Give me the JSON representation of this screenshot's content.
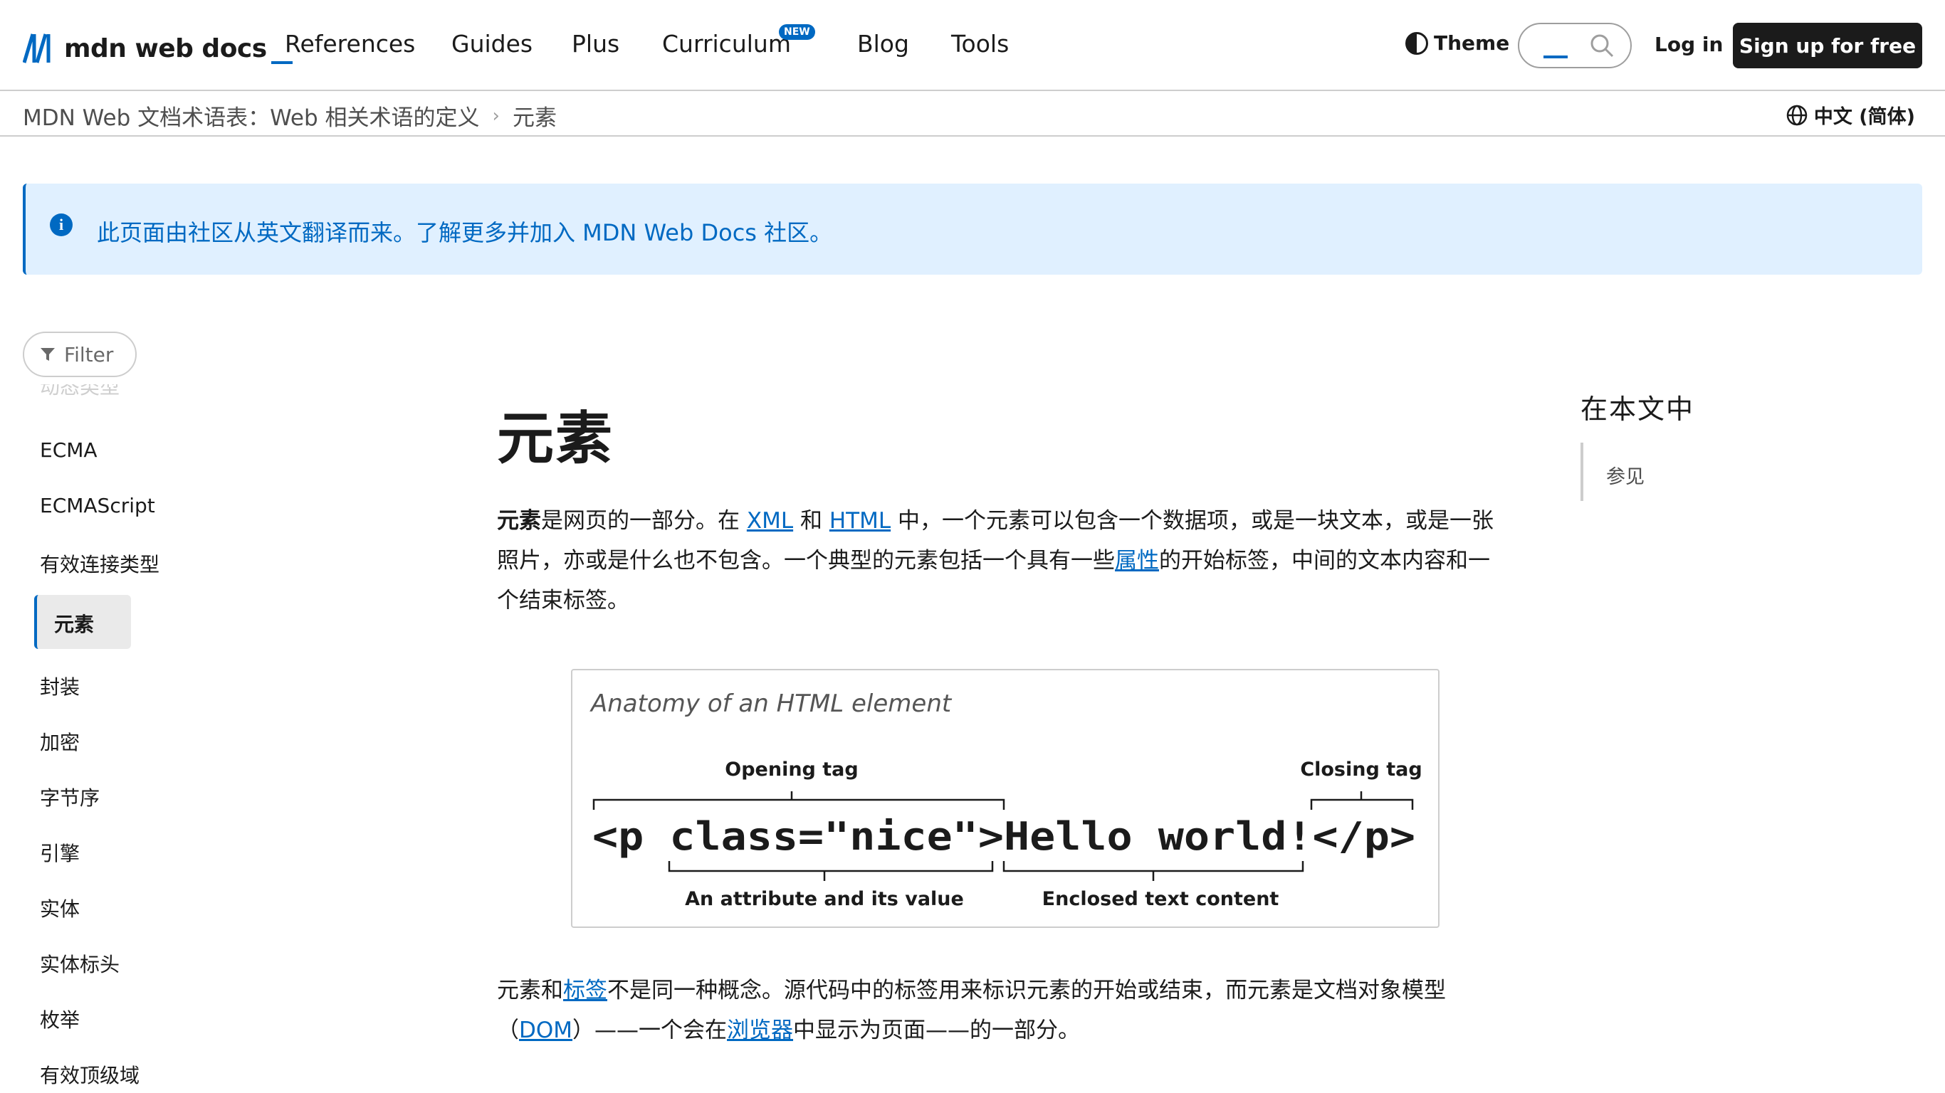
{
  "header": {
    "logo_text": "mdn web docs",
    "nav": [
      "References",
      "Guides",
      "Plus",
      "Curriculum",
      "Blog",
      "Tools"
    ],
    "curriculum_badge": "NEW",
    "theme_label": "Theme",
    "search_placeholder": "",
    "login_label": "Log in",
    "signup_label": "Sign up for free"
  },
  "breadcrumb": {
    "items": [
      "MDN Web 文档术语表：Web 相关术语的定义",
      "元素"
    ],
    "language": "中文 (简体)"
  },
  "notice": {
    "text": "此页面由社区从英文翻译而来。了解更多并加入 MDN Web Docs 社区。"
  },
  "sidebar": {
    "filter_label": "Filter",
    "faded_item": "动态类型",
    "items": [
      "ECMA",
      "ECMAScript",
      "有效连接类型",
      "元素",
      "封装",
      "加密",
      "字节序",
      "引擎",
      "实体",
      "实体标头",
      "枚举",
      "有效顶级域"
    ],
    "active_index": 3
  },
  "article": {
    "title": "元素",
    "p1": {
      "strong": "元素",
      "t1": "是网页的一部分。在 ",
      "link_xml": "XML",
      "t2": " 和 ",
      "link_html": "HTML",
      "t3": " 中，一个元素可以包含一个数据项，或是一块文本，或是一张照片，亦或是什么也不包含。一个典型的元素包括一个具有一些",
      "link_attr": "属性",
      "t4": "的开始标签，中间的文本内容和一个结束标签。"
    },
    "figure": {
      "title": "Anatomy of an HTML element",
      "opening_tag": "Opening tag",
      "closing_tag": "Closing tag",
      "code_open": "<p class=\"nice\">",
      "code_text": "Hello world!",
      "code_close": "</p>",
      "attribute_label": "An attribute and its value",
      "content_label": "Enclosed text content"
    },
    "p2": {
      "t1": "元素和",
      "link_tag": "标签",
      "t2": "不是同一种概念。源代码中的标签用来标识元素的开始或结束，而元素是文档对象模型（",
      "link_dom": "DOM",
      "t3": "）——一个会在",
      "link_browser": "浏览器",
      "t4": "中显示为页面——的一部分。"
    }
  },
  "toc": {
    "title": "在本文中",
    "items": [
      "参见"
    ]
  },
  "colors": {
    "accent": "#0069c2",
    "notice_bg": "#e0f0ff",
    "text": "#1b1b1b"
  }
}
